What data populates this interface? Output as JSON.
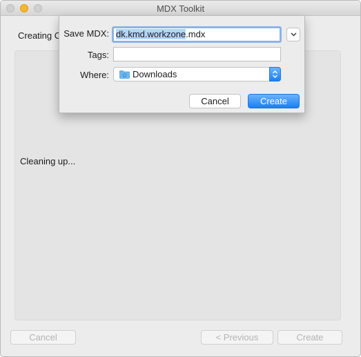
{
  "window": {
    "title": "MDX Toolkit",
    "heading": "Creating C",
    "status": "Cleaning up...",
    "buttons": {
      "cancel": "Cancel",
      "previous": "< Previous",
      "create": "Create"
    }
  },
  "dialog": {
    "save_label": "Save MDX:",
    "filename_selected": "dk.kmd.workzone",
    "filename_ext": ".mdx",
    "tags_label": "Tags:",
    "tags_value": "",
    "where_label": "Where:",
    "where_value": "Downloads",
    "where_icon": "folder-icon",
    "cancel_label": "Cancel",
    "create_label": "Create"
  },
  "colors": {
    "accent": "#1b7ef3",
    "selection": "#b5d4fb",
    "minimize": "#f5b62c"
  }
}
